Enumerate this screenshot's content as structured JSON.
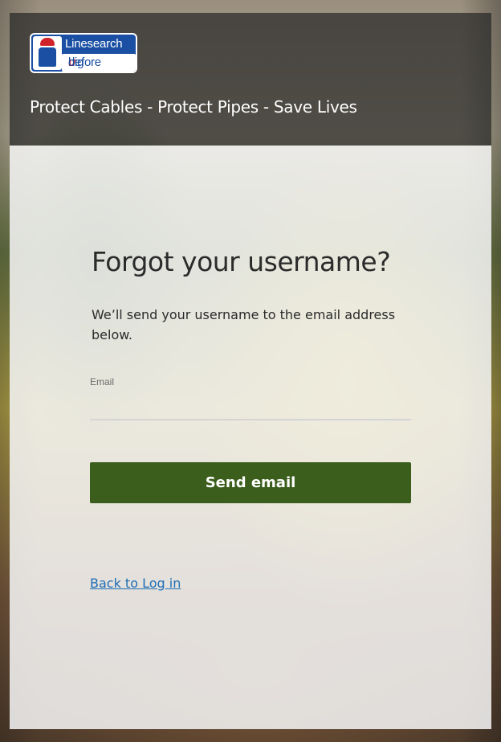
{
  "header": {
    "logo": {
      "line1": "Linesearch",
      "line2_before": "before",
      "line2_u": "u",
      "line2_dig": "dig"
    },
    "tagline": "Protect Cables - Protect Pipes - Save Lives"
  },
  "form": {
    "title": "Forgot your username?",
    "description": "We’ll send your username to the email address below.",
    "email_label": "Email",
    "email_value": "",
    "send_button": "Send email",
    "back_link": "Back to Log in"
  },
  "colors": {
    "button": "#3b5e1c",
    "link": "#1f6fb5",
    "logo_blue": "#1a4fa3",
    "logo_red": "#d0222a"
  }
}
